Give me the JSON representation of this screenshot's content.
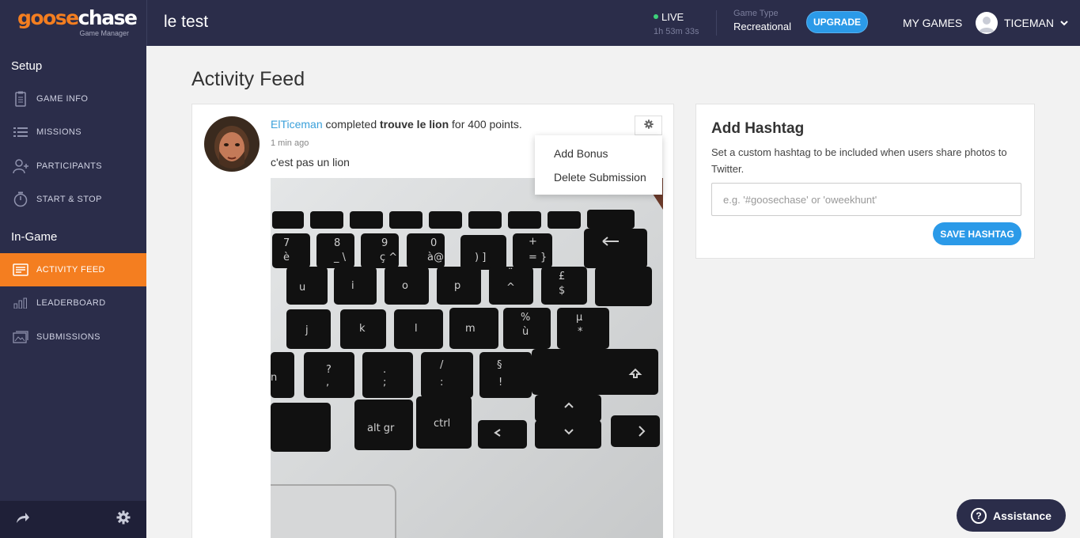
{
  "header": {
    "logo_part1": "goose",
    "logo_part2": "chase",
    "logo_sub": "Game Manager",
    "game_title": "le test",
    "live_label": "LIVE",
    "live_timer": "1h 53m 33s",
    "game_type_label": "Game Type",
    "game_type_value": "Recreational",
    "upgrade_label": "UPGRADE",
    "my_games_label": "MY GAMES",
    "username": "TICEMAN"
  },
  "sidebar": {
    "setup_heading": "Setup",
    "ingame_heading": "In-Game",
    "setup_items": [
      {
        "label": "GAME INFO",
        "icon": "clipboard-icon"
      },
      {
        "label": "MISSIONS",
        "icon": "list-icon"
      },
      {
        "label": "PARTICIPANTS",
        "icon": "user-add-icon"
      },
      {
        "label": "START & STOP",
        "icon": "timer-icon"
      }
    ],
    "ingame_items": [
      {
        "label": "ACTIVITY FEED",
        "icon": "feed-icon",
        "active": true
      },
      {
        "label": "LEADERBOARD",
        "icon": "bar-chart-icon"
      },
      {
        "label": "SUBMISSIONS",
        "icon": "photos-icon"
      }
    ]
  },
  "main": {
    "page_title": "Activity Feed",
    "feed": {
      "user": "ElTiceman",
      "verb": "completed",
      "mission": "trouve le lion",
      "points_text": "for 400 points.",
      "time": "1 min ago",
      "caption": "c'est pas un lion"
    },
    "dropdown": {
      "add_bonus": "Add Bonus",
      "delete_submission": "Delete Submission"
    },
    "hashtag": {
      "title": "Add Hashtag",
      "description": "Set a custom hashtag to be included when users share photos to Twitter.",
      "placeholder": "e.g. '#goosechase' or 'oweekhunt'",
      "save_label": "SAVE HASHTAG"
    },
    "assistance_label": "Assistance"
  },
  "colors": {
    "navy": "#2b2d4a",
    "orange": "#f47e20",
    "blue": "#2b9ae8",
    "link": "#3aa0da"
  }
}
